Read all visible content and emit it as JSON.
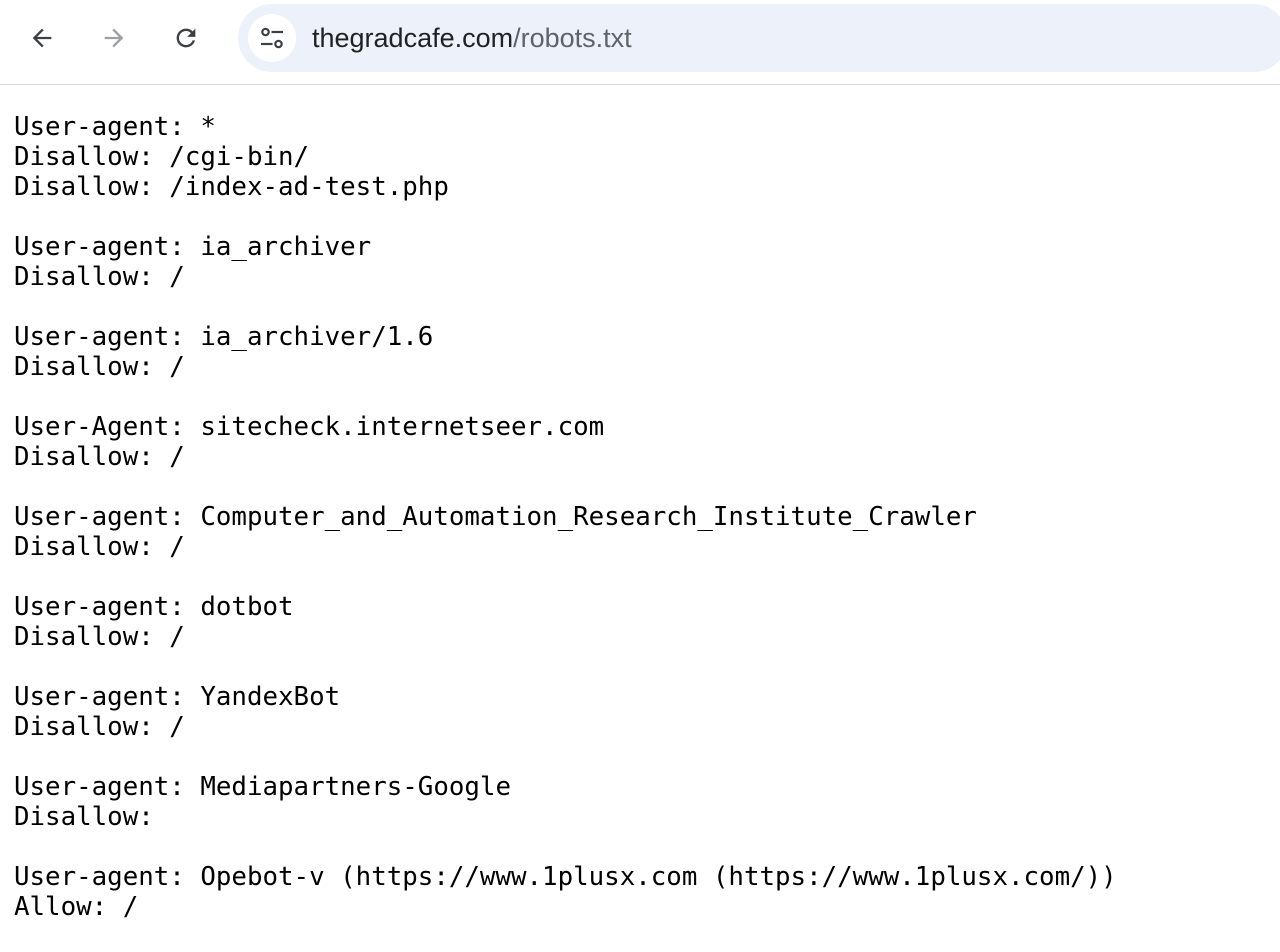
{
  "browser": {
    "back_icon": "arrow-left-icon",
    "forward_icon": "arrow-right-icon",
    "reload_icon": "reload-icon",
    "site_info_icon": "tune-icon",
    "url_host": "thegradcafe.com",
    "url_path": "/robots.txt",
    "omnibox_color": "#edf2fa"
  },
  "robots_txt": {
    "lines": [
      "User-agent: *",
      "Disallow: /cgi-bin/",
      "Disallow: /index-ad-test.php",
      "",
      "User-agent: ia_archiver",
      "Disallow: /",
      "",
      "User-agent: ia_archiver/1.6",
      "Disallow: /",
      "",
      "User-Agent: sitecheck.internetseer.com",
      "Disallow: /",
      "",
      "User-agent: Computer_and_Automation_Research_Institute_Crawler",
      "Disallow: /",
      "",
      "User-agent: dotbot",
      "Disallow: /",
      "",
      "User-agent: YandexBot",
      "Disallow: /",
      "",
      "User-agent: Mediapartners-Google",
      "Disallow:",
      "",
      "User-agent: Opebot-v (https://www.1plusx.com (https://www.1plusx.com/))",
      "Allow: /"
    ]
  }
}
